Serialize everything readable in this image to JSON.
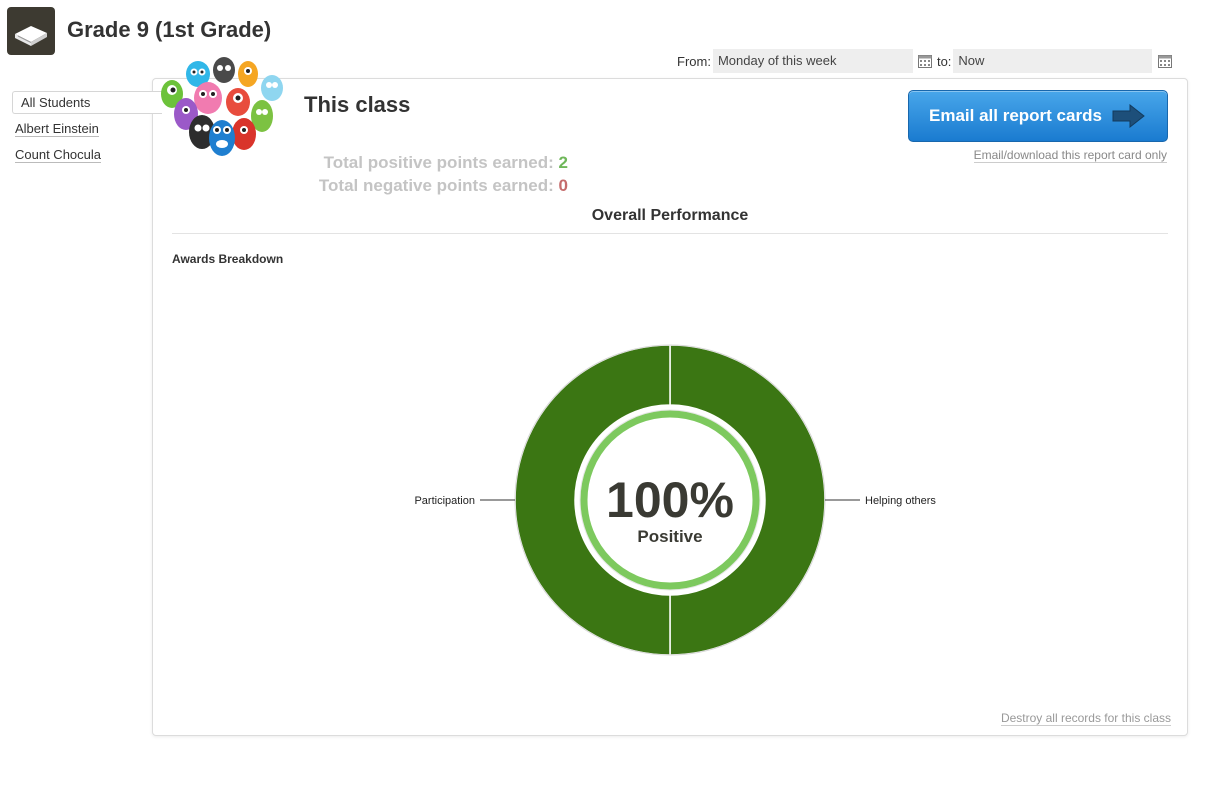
{
  "header": {
    "title": "Grade 9 (1st Grade)",
    "icon": "book-icon"
  },
  "date_range": {
    "from_label": "From:",
    "from_value": "Monday of this week",
    "to_label": "to:",
    "to_value": "Now",
    "calendar_icon": "calendar-icon"
  },
  "sidebar": {
    "items": [
      {
        "label": "All Students",
        "active": true
      },
      {
        "label": "Albert Einstein",
        "active": false
      },
      {
        "label": "Count Chocula",
        "active": false
      }
    ]
  },
  "report": {
    "class_title": "This class",
    "positive_label": "Total positive points earned:",
    "positive_value": "2",
    "negative_label": "Total negative points earned:",
    "negative_value": "0",
    "email_all_label": "Email all report cards",
    "email_only_label": "Email/download this report card only",
    "overall_title": "Overall Performance",
    "awards_title": "Awards Breakdown",
    "destroy_label": "Destroy all records for this class"
  },
  "colors": {
    "positive": "#6fb75a",
    "negative": "#c56b6b",
    "donut_fill": "#3b7613",
    "inner_ring": "#7dc95e",
    "button": "#2a8ee0"
  },
  "chart_data": {
    "type": "pie",
    "title": "",
    "categories": [
      "Helping others",
      "Participation"
    ],
    "values": [
      1,
      1
    ],
    "center_value": "100%",
    "center_label": "Positive",
    "positive_share": 1.0
  }
}
